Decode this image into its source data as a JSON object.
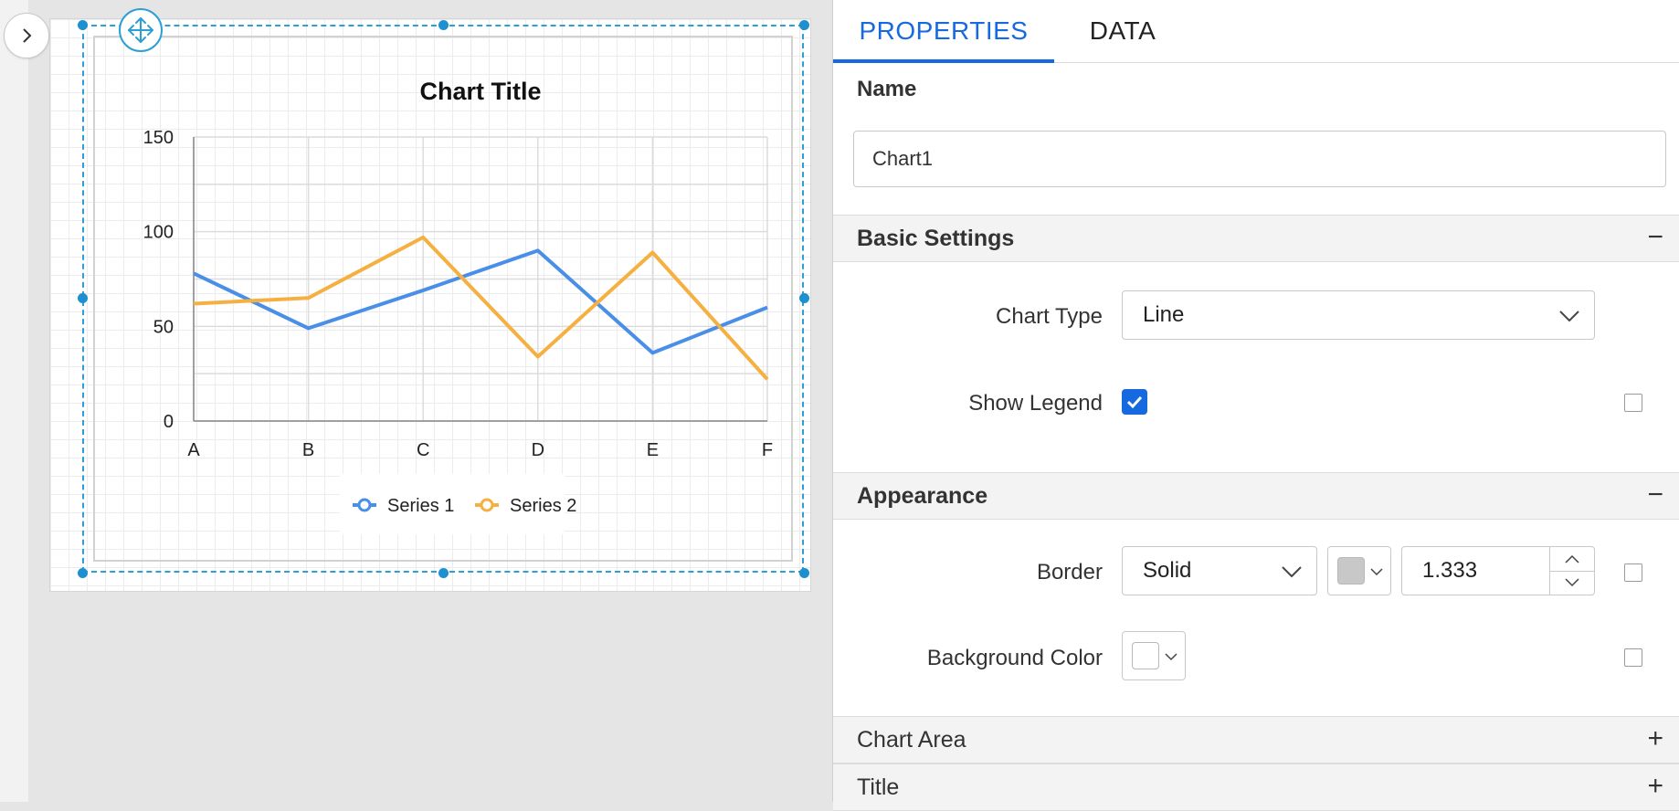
{
  "panel": {
    "tabs": [
      {
        "label": "PROPERTIES",
        "active": true
      },
      {
        "label": "DATA",
        "active": false
      }
    ],
    "name_label": "Name",
    "name_value": "Chart1",
    "basic_settings": {
      "title": "Basic Settings",
      "toggle": "−",
      "chart_type_label": "Chart Type",
      "chart_type_value": "Line",
      "show_legend_label": "Show Legend",
      "show_legend_checked": true
    },
    "appearance": {
      "title": "Appearance",
      "toggle": "−",
      "border_label": "Border",
      "border_style": "Solid",
      "border_color": "#c8c8c8",
      "border_width": "1.333",
      "background_color_label": "Background Color",
      "background_color": "#ffffff"
    },
    "chart_area": {
      "title": "Chart Area",
      "toggle": "+"
    },
    "title_section": {
      "title": "Title",
      "toggle": "+"
    }
  },
  "chart_data": {
    "type": "line",
    "title": "Chart Title",
    "categories": [
      "A",
      "B",
      "C",
      "D",
      "E",
      "F"
    ],
    "yticks": [
      0,
      50,
      100,
      150
    ],
    "ylim": [
      0,
      150
    ],
    "grid": true,
    "legend": "bottom",
    "series": [
      {
        "name": "Series 1",
        "color": "#4a8fe7",
        "values": [
          78,
          49,
          69,
          90,
          36,
          60
        ]
      },
      {
        "name": "Series 2",
        "color": "#f5b041",
        "values": [
          62,
          65,
          97,
          34,
          89,
          22
        ]
      }
    ]
  }
}
